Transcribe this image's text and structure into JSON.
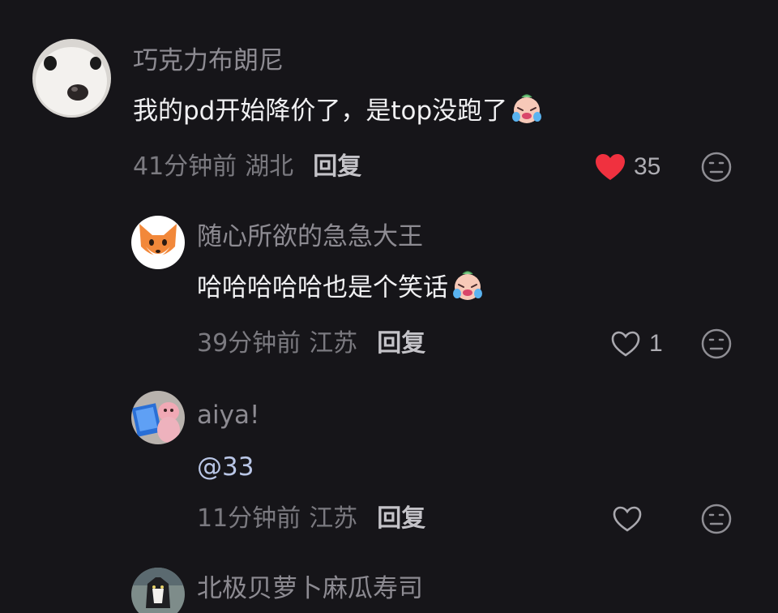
{
  "comments": [
    {
      "username": "巧克力布朗尼",
      "text": "我的pd开始降价了，是top没跑了",
      "emoji": "crying-laugh-emoji",
      "time": "41分钟前",
      "location": "湖北",
      "reply_label": "回复",
      "like_count": "35",
      "liked": true
    },
    {
      "username": "随心所欲的急急大王",
      "text": "哈哈哈哈哈也是个笑话",
      "emoji": "crying-laugh-emoji",
      "time": "39分钟前",
      "location": "江苏",
      "reply_label": "回复",
      "like_count": "1",
      "liked": false
    },
    {
      "username": "aiya!",
      "text": "@33",
      "time": "11分钟前",
      "location": "江苏",
      "reply_label": "回复",
      "like_count": "",
      "liked": false
    },
    {
      "username": "北极贝萝卜麻瓜寿司"
    }
  ],
  "colors": {
    "background": "#161519",
    "liked_heart": "#f0313f",
    "username": "#8d8b92",
    "content": "#f1f1f3"
  }
}
